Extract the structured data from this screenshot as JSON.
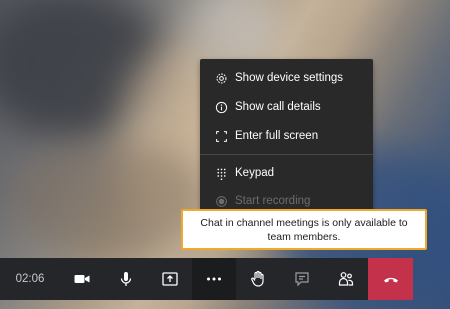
{
  "menu": {
    "items": [
      {
        "label": "Show device settings",
        "icon": "gear-icon"
      },
      {
        "label": "Show call details",
        "icon": "info-icon"
      },
      {
        "label": "Enter full screen",
        "icon": "fullscreen-icon"
      },
      {
        "label": "Keypad",
        "icon": "keypad-icon"
      },
      {
        "label": "Start recording",
        "icon": "record-icon"
      }
    ]
  },
  "tooltip": {
    "text": "Chat in channel meetings is only available to team members."
  },
  "callbar": {
    "timer": "02:06",
    "buttons": [
      "camera-icon",
      "microphone-icon",
      "share-screen-icon",
      "more-options-icon",
      "raise-hand-icon",
      "chat-icon",
      "participants-icon",
      "hang-up-icon"
    ]
  },
  "colors": {
    "menu_bg": "#292929",
    "bar_bg": "#24262a",
    "hangup": "#c4314b",
    "tooltip_border": "#f0a92a"
  }
}
